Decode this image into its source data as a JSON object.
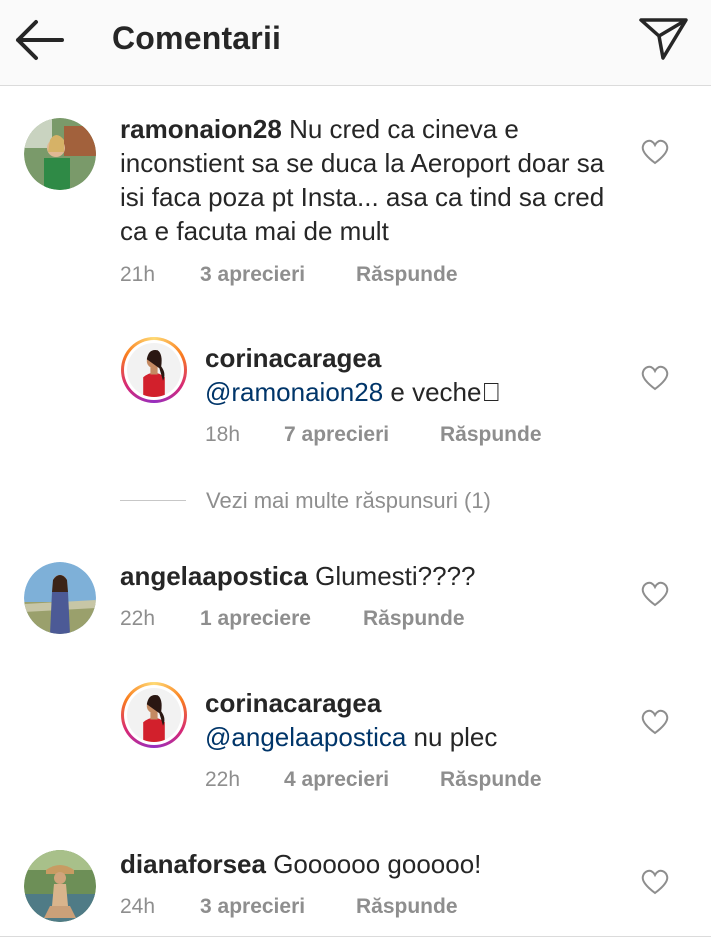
{
  "header": {
    "title": "Comentarii",
    "back_icon": "arrow-left-icon",
    "share_icon": "send-paper-plane-icon"
  },
  "comments": [
    {
      "username": "ramonaion28",
      "mention": "",
      "text": "Nu cred ca cineva e inconstient sa se duca la Aeroport doar sa isi faca poza pt Insta... asa ca tind sa cred ca e facuta mai de mult",
      "time": "21h",
      "likes": "3 aprecieri",
      "reply": "Răspunde"
    },
    {
      "username": "corinacaragea",
      "mention": "@ramonaion28",
      "text": "e veche\u0000",
      "time": "18h",
      "likes": "7 aprecieri",
      "reply": "Răspunde"
    },
    {
      "username": "angelaapostica",
      "mention": "",
      "text": "Glumesti????",
      "time": "22h",
      "likes": "1 apreciere",
      "reply": "Răspunde"
    },
    {
      "username": "corinacaragea",
      "mention": "@angelaapostica",
      "text": "nu plec",
      "time": "22h",
      "likes": "4 aprecieri",
      "reply": "Răspunde"
    },
    {
      "username": "dianaforsea",
      "mention": "",
      "text": "Goooooo gooooo!",
      "time": "24h",
      "likes": "3 aprecieri",
      "reply": "Răspunde"
    }
  ],
  "more_replies": "Vezi mai multe răspunsuri (1)",
  "colors": {
    "mention": "#003569",
    "meta": "#8e8e8e",
    "text": "#262626",
    "ring_gradient": [
      "#feda75",
      "#fa7e1e",
      "#d62976",
      "#962fbf"
    ]
  }
}
